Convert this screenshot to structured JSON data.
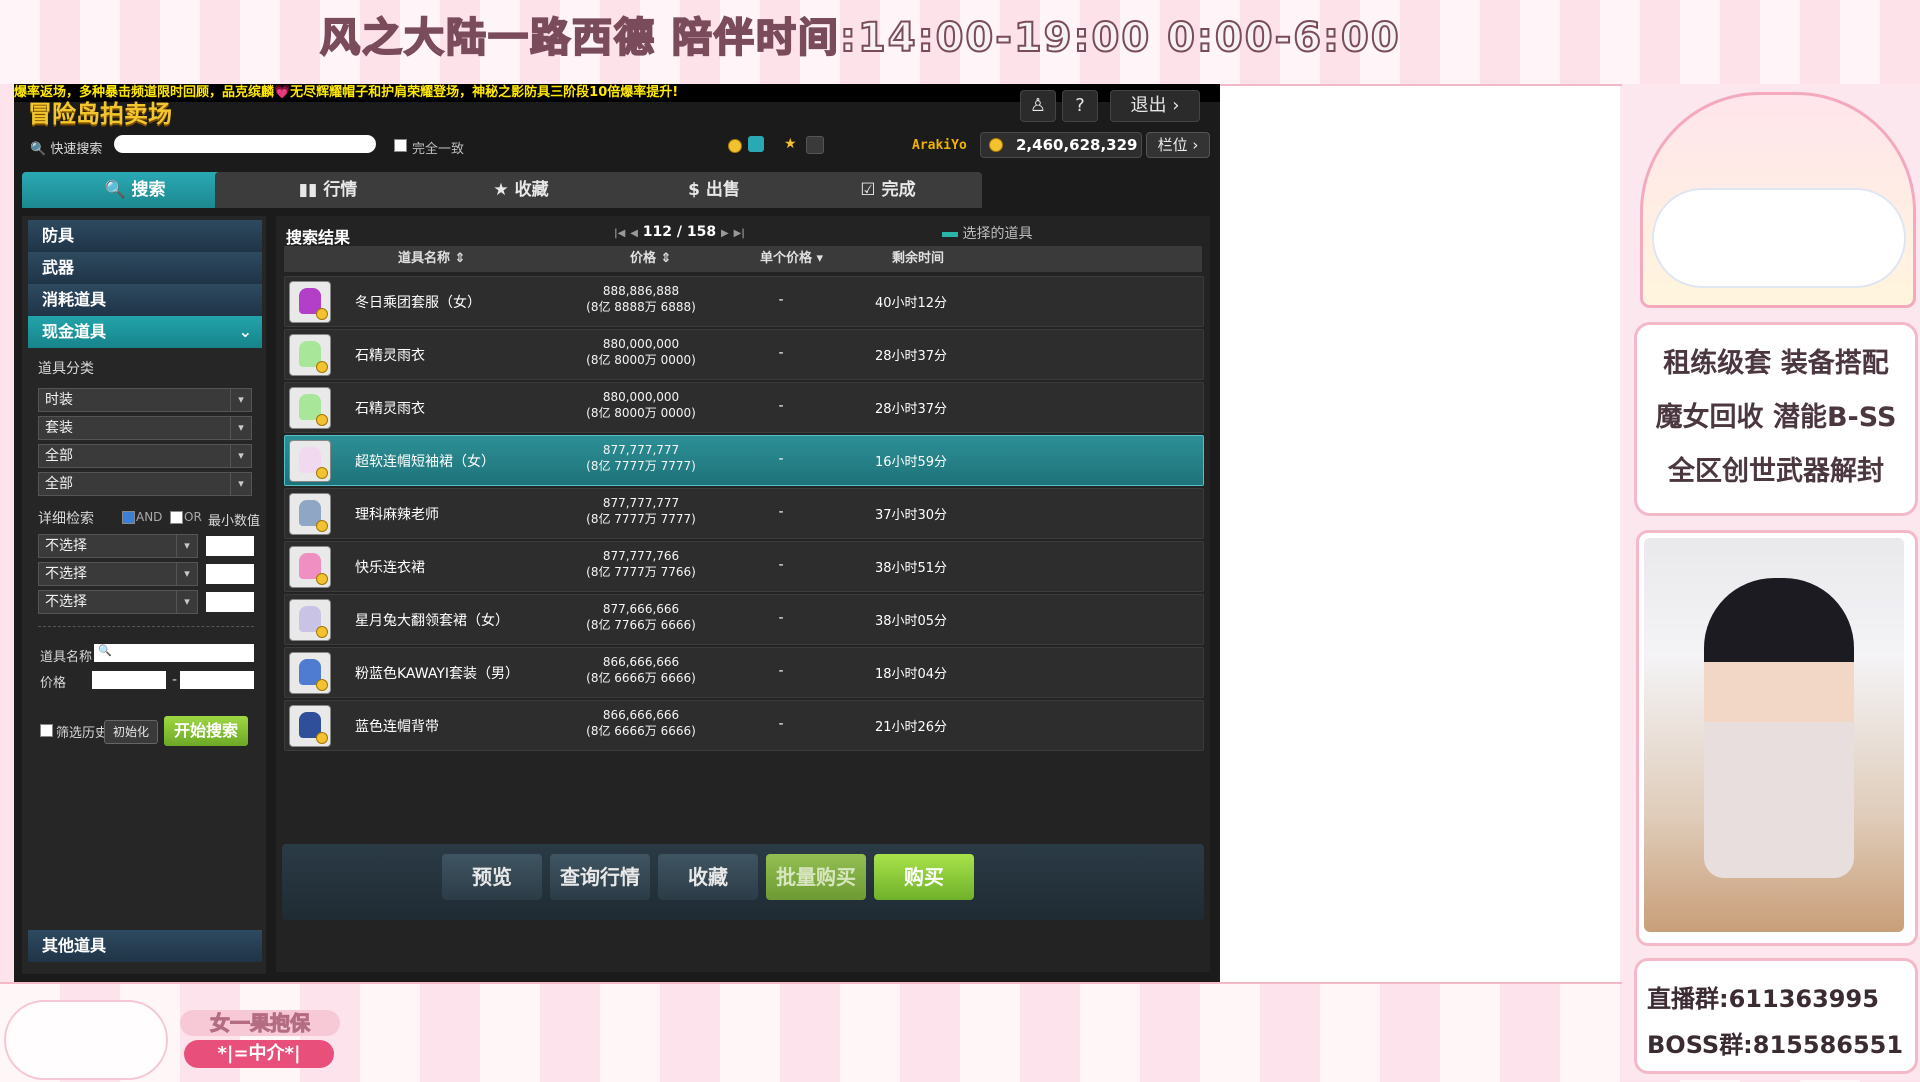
{
  "overlay": {
    "stream_title": "风之大陆一路西德  陪伴时间:14:00-19:00  0:00-6:00",
    "brand_small": "女一果抱保",
    "brand_tag": "*|=中介*|",
    "promo_lines": [
      "租练级套  装备搭配",
      "魔女回收  潜能B-SS",
      "全区创世武器解封"
    ],
    "live_group": "直播群:611363995",
    "boss_group": "BOSS群:815586551"
  },
  "game": {
    "ticker": "爆率返场，多种暴击频道限时回顾，品克缤麟💗无尽辉耀帽子和护肩荣耀登场，神秘之影防具三阶段10倍爆率提升!",
    "title": "冒险岛拍卖场",
    "top_buttons": {
      "people": "♙",
      "help": "?",
      "exit": "退出 ›"
    },
    "quick_search_label": "快速搜索",
    "exact_match_label": "完全一致",
    "username": "ArakiYo",
    "meso": "2,460,628,329",
    "slot_button": "栏位 ›",
    "tabs": [
      {
        "icon": "🔍",
        "label": "搜索"
      },
      {
        "icon": "▮▮",
        "label": "行情"
      },
      {
        "icon": "★",
        "label": "收藏"
      },
      {
        "icon": "$",
        "label": "出售"
      },
      {
        "icon": "☑",
        "label": "完成"
      }
    ],
    "categories": [
      "防具",
      "武器",
      "消耗道具",
      "现金道具",
      "其他道具"
    ],
    "category_chevron": "⌄",
    "item_class_label": "道具分类",
    "dropdowns": [
      "时装",
      "套装",
      "全部",
      "全部"
    ],
    "detail_label": "详细检索",
    "and_label": "AND",
    "or_label": "OR",
    "min_label": "最小数值",
    "detail_selects": [
      "不选择",
      "不选择",
      "不选择"
    ],
    "name_label": "道具名称",
    "price_label": "价格",
    "price_dash": "-",
    "history_label": "筛选历史",
    "reset_label": "初始化",
    "search_button": "开始搜索"
  },
  "results": {
    "title": "搜索结果",
    "page_current": "112",
    "page_total": "158",
    "legend_label": "选择的道具",
    "headers": {
      "name": "道具名称 ⇕",
      "price": "价格 ⇕",
      "unit": "单个价格 ▾",
      "time": "剩余时间"
    },
    "rows": [
      {
        "name": "冬日乘团套服（女）",
        "price": "888,886,888",
        "price_sub": "(8亿 8888万 6888)",
        "unit": "-",
        "time": "40小时12分",
        "color": "#b33fc9"
      },
      {
        "name": "石精灵雨衣",
        "price": "880,000,000",
        "price_sub": "(8亿 8000万 0000)",
        "unit": "-",
        "time": "28小时37分",
        "color": "#a8e79a"
      },
      {
        "name": "石精灵雨衣",
        "price": "880,000,000",
        "price_sub": "(8亿 8000万 0000)",
        "unit": "-",
        "time": "28小时37分",
        "color": "#a8e79a"
      },
      {
        "name": "超软连帽短袖裙（女）",
        "price": "877,777,777",
        "price_sub": "(8亿 7777万 7777)",
        "unit": "-",
        "time": "16小时59分",
        "color": "#f1d9ef"
      },
      {
        "name": "理科麻辣老师",
        "price": "877,777,777",
        "price_sub": "(8亿 7777万 7777)",
        "unit": "-",
        "time": "37小时30分",
        "color": "#8fa6c4"
      },
      {
        "name": "快乐连衣裙",
        "price": "877,777,766",
        "price_sub": "(8亿 7777万 7766)",
        "unit": "-",
        "time": "38小时51分",
        "color": "#f08fc1"
      },
      {
        "name": "星月兔大翻领套裙（女）",
        "price": "877,666,666",
        "price_sub": "(8亿 7766万 6666)",
        "unit": "-",
        "time": "38小时05分",
        "color": "#c9c3e6"
      },
      {
        "name": "粉蓝色KAWAYI套装（男）",
        "price": "866,666,666",
        "price_sub": "(8亿 6666万 6666)",
        "unit": "-",
        "time": "18小时04分",
        "color": "#4f7cd1"
      },
      {
        "name": "蓝色连帽背带",
        "price": "866,666,666",
        "price_sub": "(8亿 6666万 6666)",
        "unit": "-",
        "time": "21小时26分",
        "color": "#2f4f9a"
      }
    ],
    "actions": [
      "预览",
      "查询行情",
      "收藏",
      "批量购买",
      "购买"
    ]
  }
}
